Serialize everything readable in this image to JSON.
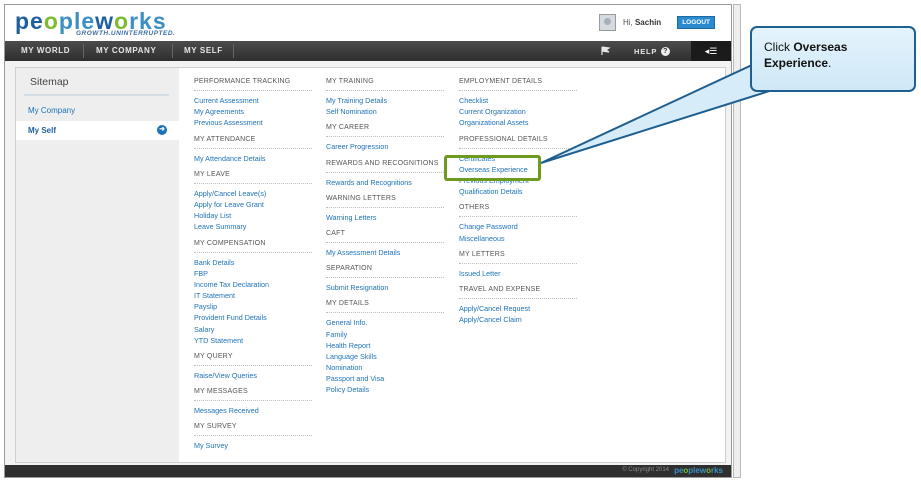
{
  "brand": {
    "logo_parts": [
      "pe",
      "o",
      "ple",
      "w",
      "o",
      "rks"
    ],
    "tagline": "GROWTH.UNINTERRUPTED."
  },
  "user": {
    "greeting": "Hi,",
    "name": "Sachin",
    "logout_label": "LOGOUT"
  },
  "nav": {
    "items": [
      "MY WORLD",
      "MY COMPANY",
      "MY SELF"
    ],
    "help_label": "HELP",
    "help_glyph": "?",
    "menu_glyph": "◂☰"
  },
  "sidebar": {
    "title": "Sitemap",
    "items": [
      {
        "label": "My Company",
        "active": false
      },
      {
        "label": "My Self",
        "active": true
      }
    ],
    "active_glyph": "➜"
  },
  "columns": [
    {
      "sections": [
        {
          "heading": "PERFORMANCE TRACKING",
          "links": [
            "Current Assessment",
            "My Agreements",
            "Previous Assessment"
          ]
        },
        {
          "heading": "MY ATTENDANCE",
          "links": [
            "My Attendance Details"
          ]
        },
        {
          "heading": "MY LEAVE",
          "links": [
            "Apply/Cancel Leave(s)",
            "Apply for Leave Grant",
            "Holiday List",
            "Leave Summary"
          ]
        },
        {
          "heading": "MY COMPENSATION",
          "links": [
            "Bank Details",
            "FBP",
            "Income Tax Declaration",
            "IT Statement",
            "Payslip",
            "Provident Fund Details",
            "Salary",
            "YTD Statement"
          ]
        },
        {
          "heading": "MY QUERY",
          "links": [
            "Raise/View Queries"
          ]
        },
        {
          "heading": "MY MESSAGES",
          "links": [
            "Messages Received"
          ]
        },
        {
          "heading": "MY SURVEY",
          "links": [
            "My Survey"
          ]
        }
      ]
    },
    {
      "sections": [
        {
          "heading": "MY TRAINING",
          "links": [
            "My Training Details",
            "Self Nomination"
          ]
        },
        {
          "heading": "MY CAREER",
          "links": [
            "Career Progression"
          ]
        },
        {
          "heading": "REWARDS AND RECOGNITIONS",
          "links": [
            "Rewards and Recognitions"
          ]
        },
        {
          "heading": "WARNING LETTERS",
          "links": [
            "Warning Letters"
          ]
        },
        {
          "heading": "CAFT",
          "links": [
            "My Assessment Details"
          ]
        },
        {
          "heading": "SEPARATION",
          "links": [
            "Submit Resignation"
          ]
        },
        {
          "heading": "MY DETAILS",
          "links": [
            "General Info.",
            "Family",
            "Health Report",
            "Language Skills",
            "Nomination",
            "Passport and Visa",
            "Policy Details"
          ]
        }
      ]
    },
    {
      "sections": [
        {
          "heading": "EMPLOYMENT DETAILS",
          "links": [
            "Checklist",
            "Current Organization",
            "Organizational Assets"
          ]
        },
        {
          "heading": "PROFESSIONAL DETAILS",
          "links": [
            "Certificates",
            "Overseas Experience",
            "Previous Employment",
            "Qualification Details"
          ]
        },
        {
          "heading": "OTHERS",
          "links": [
            "Change Password",
            "Miscellaneous"
          ]
        },
        {
          "heading": "MY LETTERS",
          "links": [
            "Issued Letter"
          ]
        },
        {
          "heading": "TRAVEL AND EXPENSE",
          "links": [
            "Apply/Cancel Request",
            "Apply/Cancel Claim"
          ]
        }
      ]
    }
  ],
  "footer": {
    "copyright": "© Copyright 2014",
    "logo_parts": [
      "pe",
      "o",
      "ple",
      "w",
      "o",
      "rks"
    ]
  },
  "callout": {
    "prefix": "Click ",
    "bold": "Overseas Experience",
    "suffix": "."
  },
  "colors": {
    "accent": "#1e72b8",
    "highlight": "#6e9a1e",
    "callout_border": "#1f5f8f"
  }
}
